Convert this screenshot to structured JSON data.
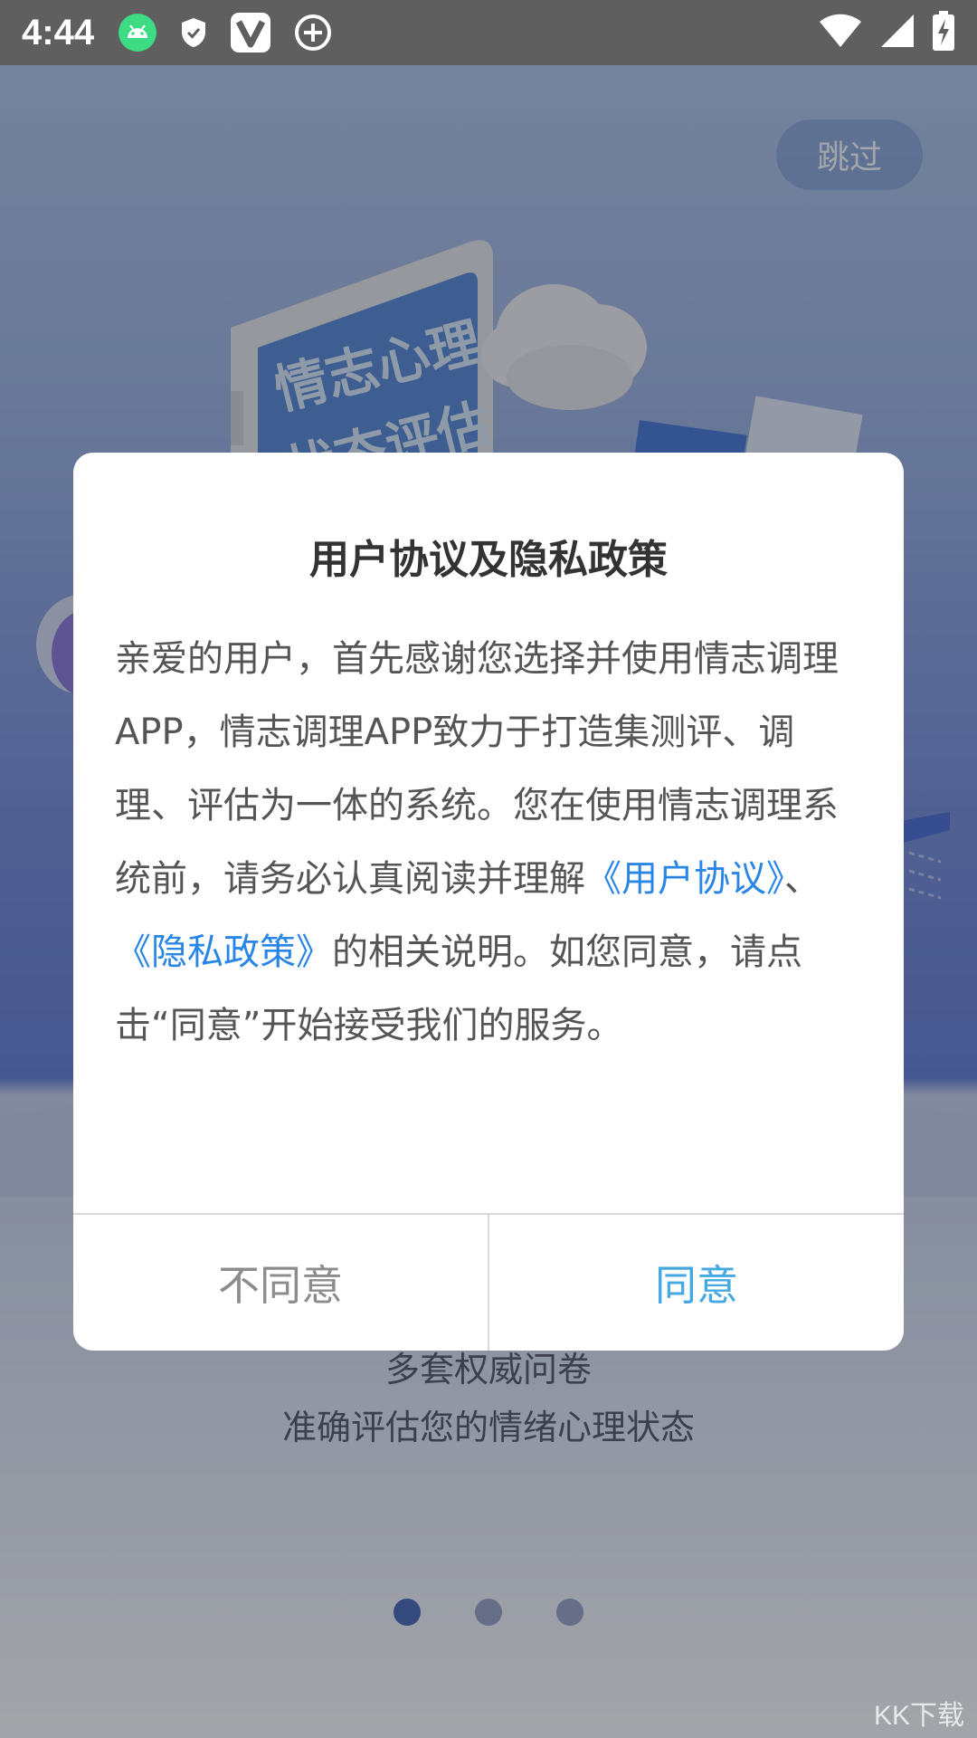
{
  "status_bar": {
    "time": "4:44",
    "icons": [
      "android-icon",
      "shield-icon",
      "v-app-icon",
      "add-circle-icon",
      "wifi-icon",
      "signal-icon",
      "battery-charging-icon"
    ]
  },
  "skip_label": "跳过",
  "illustration": {
    "screen_text_line1": "情志心理",
    "screen_text_line2": "状态评估"
  },
  "caption": {
    "line1": "多套权威问卷",
    "line2": "准确评估您的情绪心理状态"
  },
  "pager": {
    "count": 3,
    "active": 1
  },
  "dialog": {
    "title": "用户协议及隐私政策",
    "body_part1": "亲爱的用户，首先感谢您选择并使用情志调理APP，情志调理APP致力于打造集测评、调理、评估为一体的系统。您在使用情志调理系统前，请务必认真阅读并理解",
    "link_user_agreement": "《用户协议》",
    "separator": "、",
    "link_privacy_policy": "《隐私政策》",
    "body_part2": "的相关说明。如您同意，请点击“同意”开始接受我们的服务。",
    "disagree_label": "不同意",
    "agree_label": "同意"
  },
  "watermark": "KK下载",
  "colors": {
    "link": "#2a86e6",
    "agree": "#45a8e0",
    "pager_active": "#3d5fb5"
  }
}
